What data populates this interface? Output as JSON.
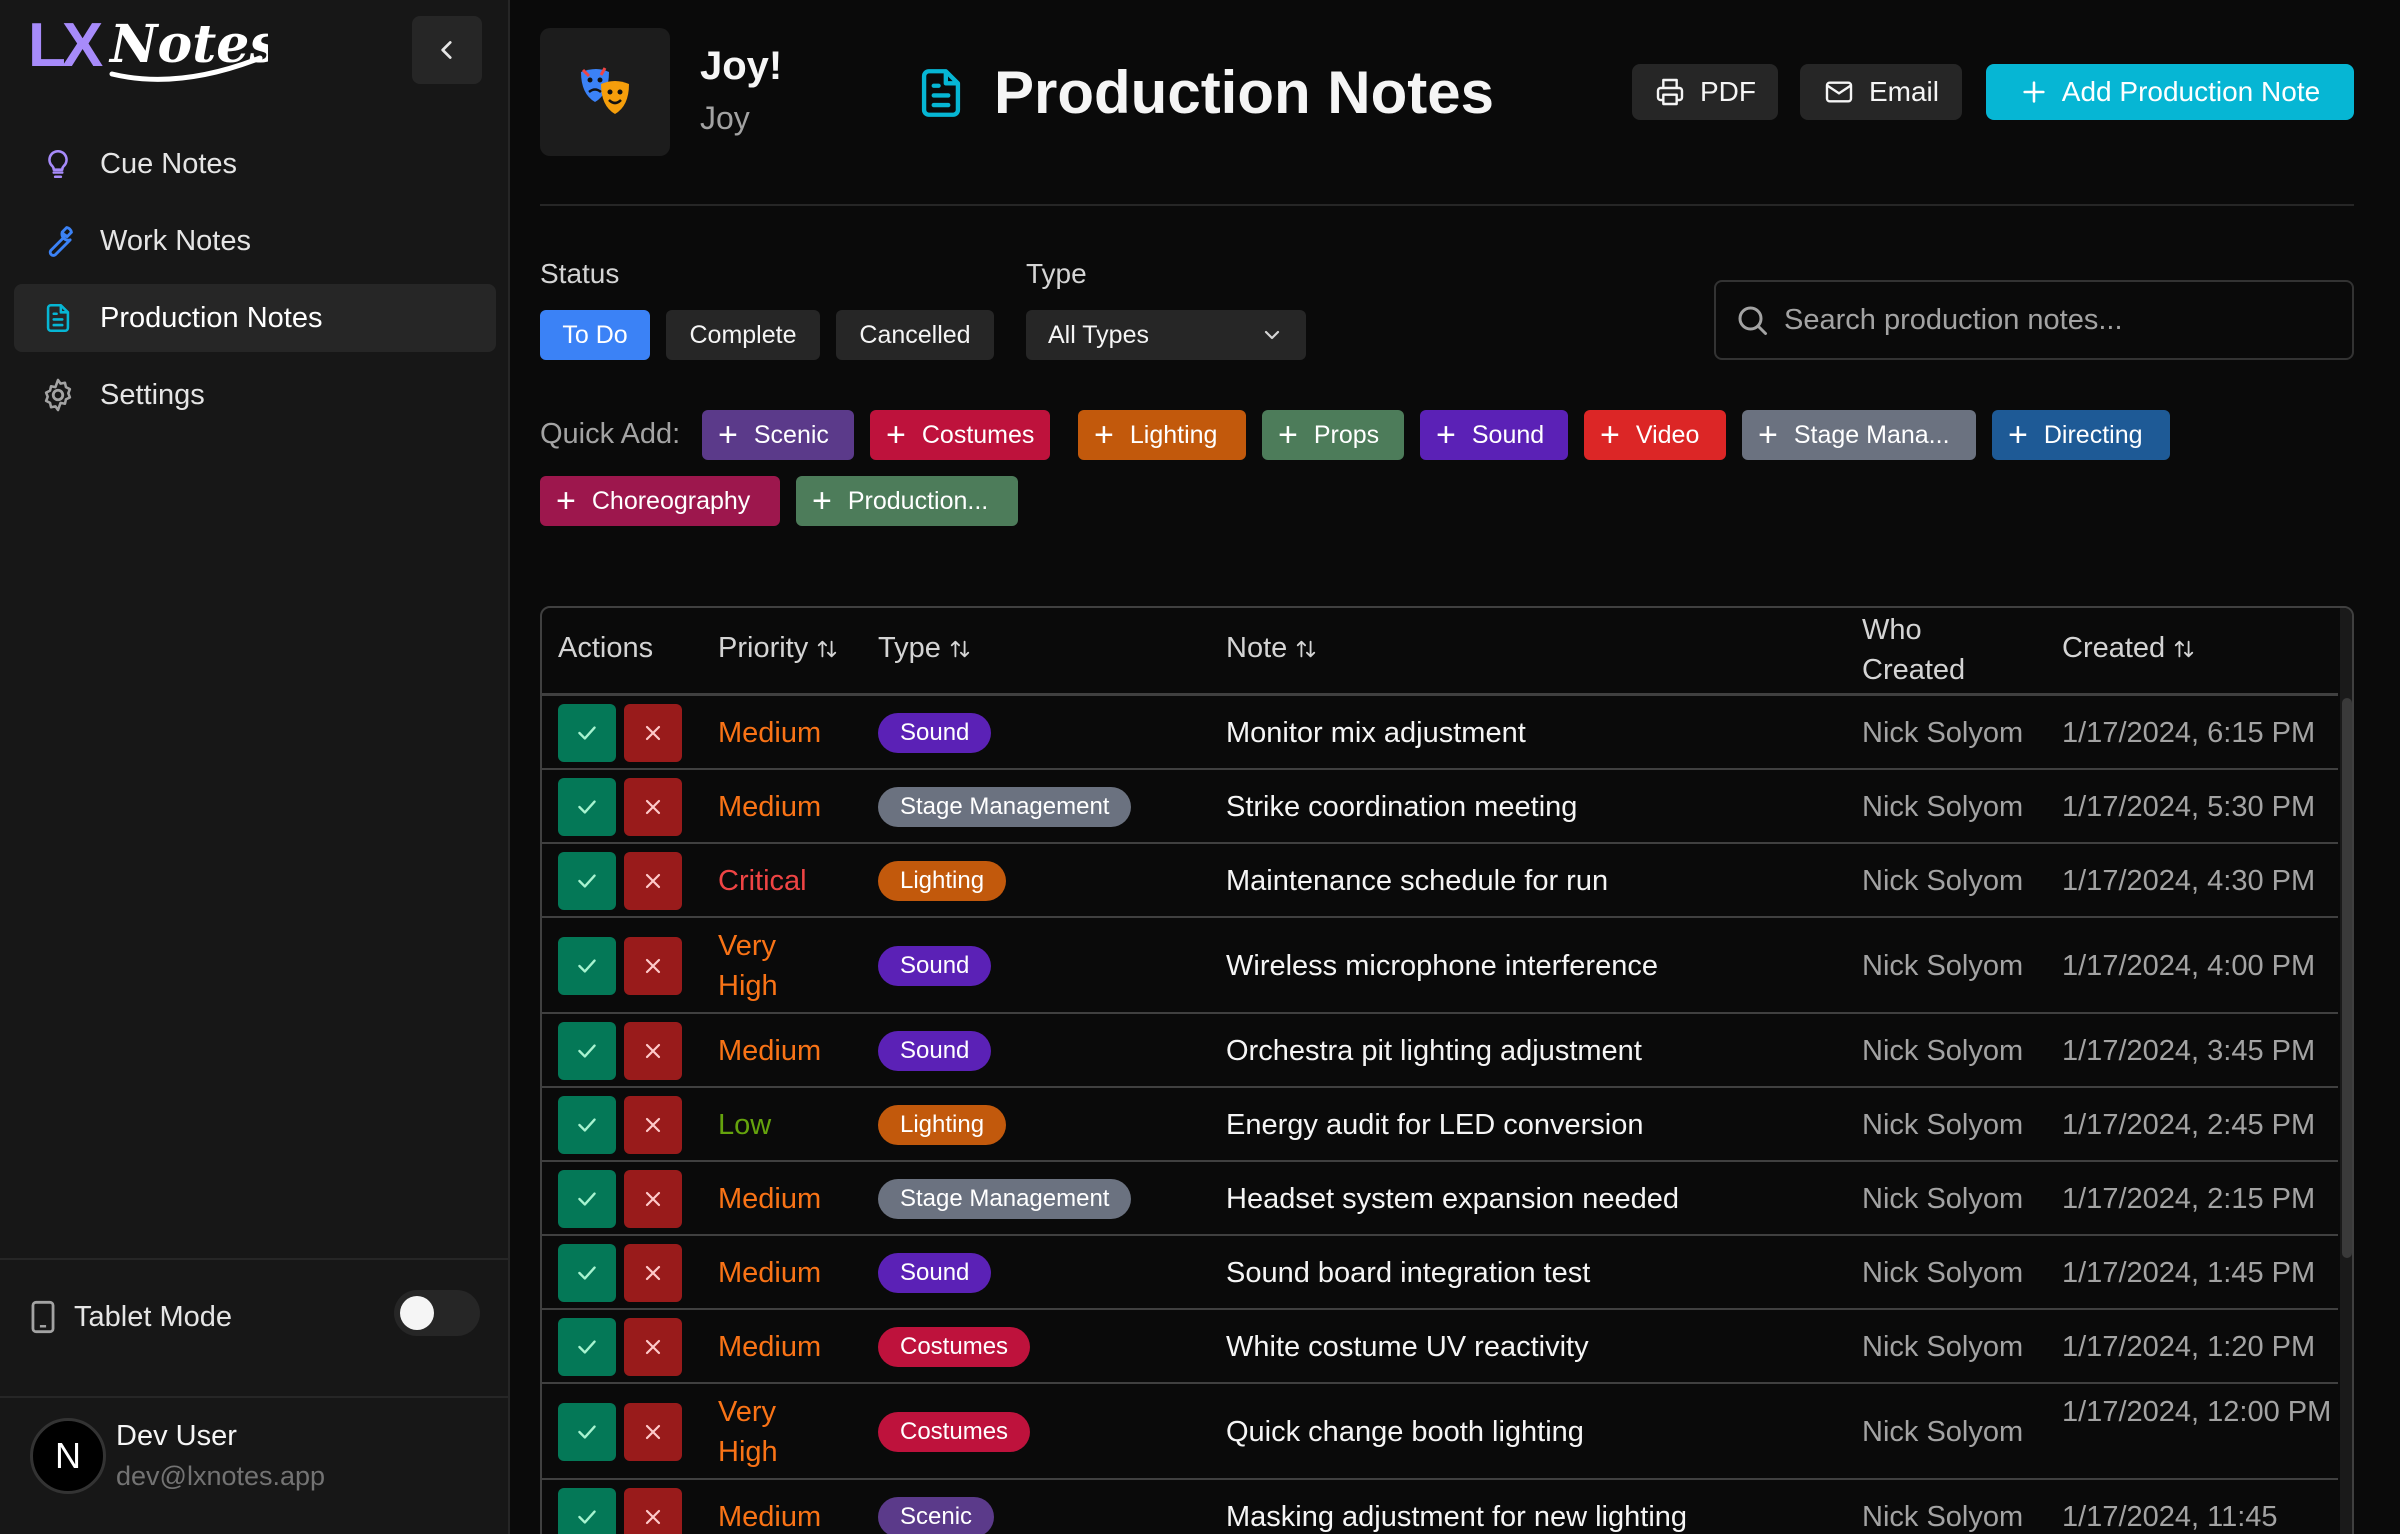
{
  "app": {
    "logo_text": "LX Notes"
  },
  "sidebar": {
    "items": [
      {
        "label": "Cue Notes",
        "icon": "lightbulb-icon"
      },
      {
        "label": "Work Notes",
        "icon": "wrench-icon"
      },
      {
        "label": "Production Notes",
        "icon": "document-icon",
        "active": true
      },
      {
        "label": "Settings",
        "icon": "gear-icon"
      }
    ],
    "tablet_mode_label": "Tablet Mode",
    "tablet_mode_on": false,
    "user": {
      "initial": "N",
      "name": "Dev User",
      "email": "dev@lxnotes.app"
    }
  },
  "header": {
    "production_title": "Joy!",
    "production_subtitle": "Joy",
    "page_title": "Production Notes",
    "pdf_label": "PDF",
    "email_label": "Email",
    "add_label": "Add Production Note"
  },
  "filters": {
    "status_label": "Status",
    "status_options": [
      "To Do",
      "Complete",
      "Cancelled"
    ],
    "status_selected": "To Do",
    "type_label": "Type",
    "type_selected": "All Types",
    "search_placeholder": "Search production notes..."
  },
  "quick_add": {
    "label": "Quick Add:",
    "chips": [
      {
        "label": "Scenic",
        "color": "#5b3a8a"
      },
      {
        "label": "Costumes",
        "color": "#be123c"
      },
      {
        "label": "Lighting",
        "color": "#c2590c"
      },
      {
        "label": "Props",
        "color": "#4d7c5a"
      },
      {
        "label": "Sound",
        "color": "#5b21b6"
      },
      {
        "label": "Video",
        "color": "#dc2626"
      },
      {
        "label": "Stage Mana...",
        "color": "#6b7280"
      },
      {
        "label": "Directing",
        "color": "#1e5a96"
      },
      {
        "label": "Choreography",
        "color": "#9d174d"
      },
      {
        "label": "Production...",
        "color": "#4d7c5a"
      }
    ]
  },
  "table": {
    "headers": {
      "actions": "Actions",
      "priority": "Priority",
      "type": "Type",
      "note": "Note",
      "who_line1": "Who",
      "who_line2": "Created",
      "created": "Created"
    },
    "priority_colors": {
      "Medium": "#f97316",
      "Critical": "#ef4444",
      "Very High": "#f97316",
      "Low": "#65a30d"
    },
    "type_colors": {
      "Sound": "#5b21b6",
      "Stage Management": "#6b7280",
      "Lighting": "#c2590c",
      "Costumes": "#be123c",
      "Scenic": "#5b3a8a"
    },
    "rows": [
      {
        "priority": "Medium",
        "type": "Sound",
        "note": "Monitor mix adjustment",
        "who": "Nick Solyom",
        "created": "1/17/2024, 6:15 PM"
      },
      {
        "priority": "Medium",
        "type": "Stage Management",
        "note": "Strike coordination meeting",
        "who": "Nick Solyom",
        "created": "1/17/2024, 5:30 PM"
      },
      {
        "priority": "Critical",
        "type": "Lighting",
        "note": "Maintenance schedule for run",
        "who": "Nick Solyom",
        "created": "1/17/2024, 4:30 PM"
      },
      {
        "priority": "Very High",
        "type": "Sound",
        "note": "Wireless microphone interference",
        "who": "Nick Solyom",
        "created": "1/17/2024, 4:00 PM"
      },
      {
        "priority": "Medium",
        "type": "Sound",
        "note": "Orchestra pit lighting adjustment",
        "who": "Nick Solyom",
        "created": "1/17/2024, 3:45 PM"
      },
      {
        "priority": "Low",
        "type": "Lighting",
        "note": "Energy audit for LED conversion",
        "who": "Nick Solyom",
        "created": "1/17/2024, 2:45 PM"
      },
      {
        "priority": "Medium",
        "type": "Stage Management",
        "note": "Headset system expansion needed",
        "who": "Nick Solyom",
        "created": "1/17/2024, 2:15 PM"
      },
      {
        "priority": "Medium",
        "type": "Sound",
        "note": "Sound board integration test",
        "who": "Nick Solyom",
        "created": "1/17/2024, 1:45 PM"
      },
      {
        "priority": "Medium",
        "type": "Costumes",
        "note": "White costume UV reactivity",
        "who": "Nick Solyom",
        "created": "1/17/2024, 1:20 PM"
      },
      {
        "priority": "Very High",
        "type": "Costumes",
        "note": "Quick change booth lighting",
        "who": "Nick Solyom",
        "created": "1/17/2024, 12:00 PM"
      },
      {
        "priority": "Medium",
        "type": "Scenic",
        "note": "Masking adjustment for new lighting",
        "who": "Nick Solyom",
        "created": "1/17/2024, 11:45"
      }
    ]
  }
}
